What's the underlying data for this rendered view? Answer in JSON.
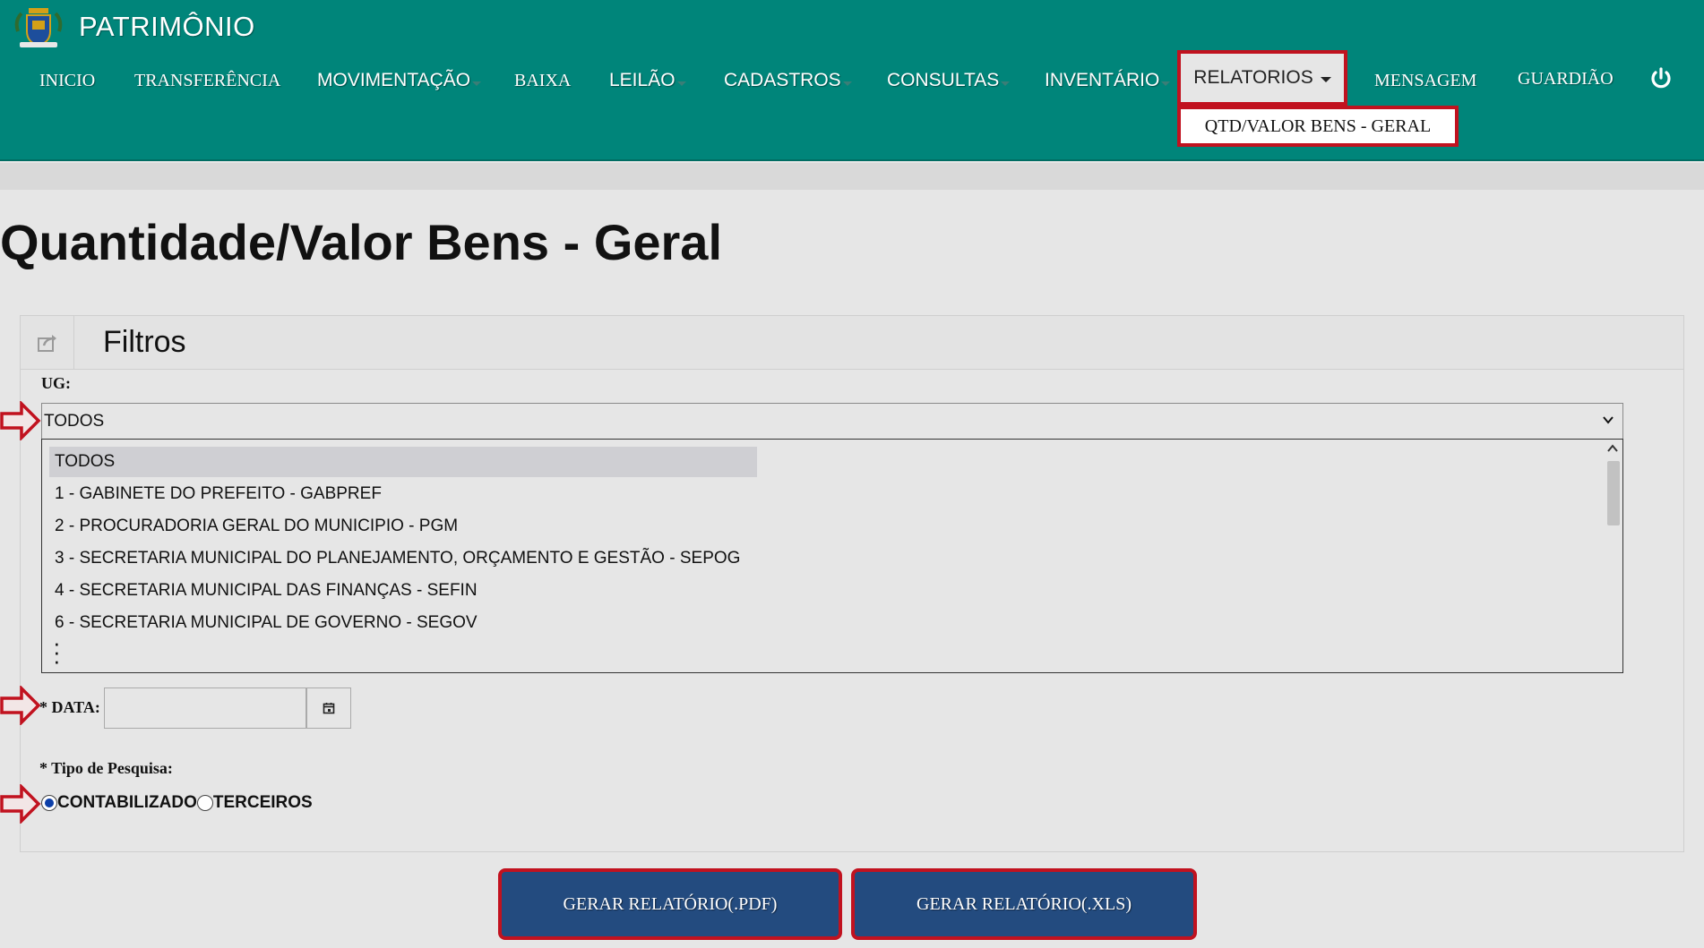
{
  "app": {
    "title": "PATRIMÔNIO"
  },
  "nav": {
    "inicio": "INICIO",
    "transferencia": "TRANSFERÊNCIA",
    "movimentacao": "MOVIMENTAÇÃO",
    "baixa": "BAIXA",
    "leilao": "LEILÃO",
    "cadastros": "CADASTROS",
    "consultas": "CONSULTAS",
    "inventario": "INVENTÁRIO",
    "relatorios": "RELATORIOS",
    "mensagem": "MENSAGEM",
    "guardiao": "GUARDIÃO",
    "relatorios_menu_item": "QTD/VALOR BENS - GERAL"
  },
  "page": {
    "title": "Quantidade/Valor Bens - Geral"
  },
  "filters": {
    "panel_title": "Filtros",
    "ug_label": "UG:",
    "ug_selected": "TODOS",
    "ug_options": [
      "TODOS",
      "1 - GABINETE DO PREFEITO - GABPREF",
      "2 - PROCURADORIA GERAL DO MUNICIPIO - PGM",
      "3 - SECRETARIA MUNICIPAL DO PLANEJAMENTO, ORÇAMENTO E GESTÃO - SEPOG",
      "4 - SECRETARIA MUNICIPAL DAS FINANÇAS - SEFIN",
      "6 - SECRETARIA MUNICIPAL DE GOVERNO - SEGOV"
    ],
    "data_label": "* DATA:",
    "data_value": "",
    "tipo_label": "* Tipo de Pesquisa:",
    "tipo_options": [
      "CONTABILIZADO",
      "TERCEIROS"
    ],
    "tipo_selected": "CONTABILIZADO"
  },
  "actions": {
    "pdf_label": "GERAR RELATÓRIO(.PDF)",
    "xls_label": "GERAR RELATÓRIO(.XLS)"
  },
  "colors": {
    "header": "#00857a",
    "highlight": "#c1121f",
    "button": "#234b7f"
  },
  "icons": [
    "brasao-logo",
    "caret-down-icon",
    "power-icon",
    "share-icon",
    "chevron-down-icon",
    "calendar-icon",
    "red-arrow-icon"
  ]
}
